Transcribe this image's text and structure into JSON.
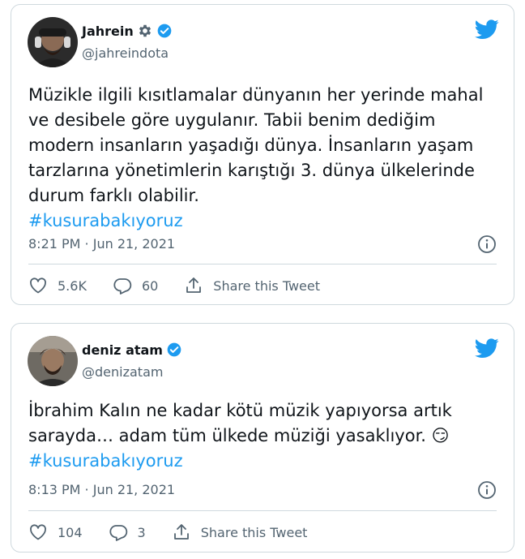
{
  "tweets": [
    {
      "name": "Jahrein",
      "handle": "@jahreindota",
      "text": "Müzikle ilgili kısıtlamalar dünyanın her yerinde mahal ve desibele göre uygulanır. Tabii benim dediğim modern insanların yaşadığı dünya. İnsanların yaşam tarzlarına yönetimlerin karıştığı 3. dünya ülkelerinde durum farklı olabilir.",
      "hashtag": "#kusurabakıyoruz",
      "time": "8:21 PM · Jun 21, 2021",
      "likes": "5.6K",
      "replies": "60",
      "share_label": "Share this Tweet"
    },
    {
      "name": "deniz atam",
      "handle": "@denizatam",
      "text": "İbrahim Kalın ne kadar kötü müzik yapıyorsa artık sarayda… adam tüm ülkede müziği yasaklıyor. 😏",
      "hashtag": "#kusurabakıyoruz",
      "time": "8:13 PM · Jun 21, 2021",
      "likes": "104",
      "replies": "3",
      "share_label": "Share this Tweet"
    }
  ],
  "colors": {
    "brand_blue": "#1d9bf0",
    "text_secondary": "#536471",
    "border": "#cfd9de"
  },
  "icons": [
    "gear-icon",
    "verified-badge-icon",
    "twitter-bird-icon",
    "info-icon",
    "heart-icon",
    "reply-icon",
    "share-icon"
  ]
}
